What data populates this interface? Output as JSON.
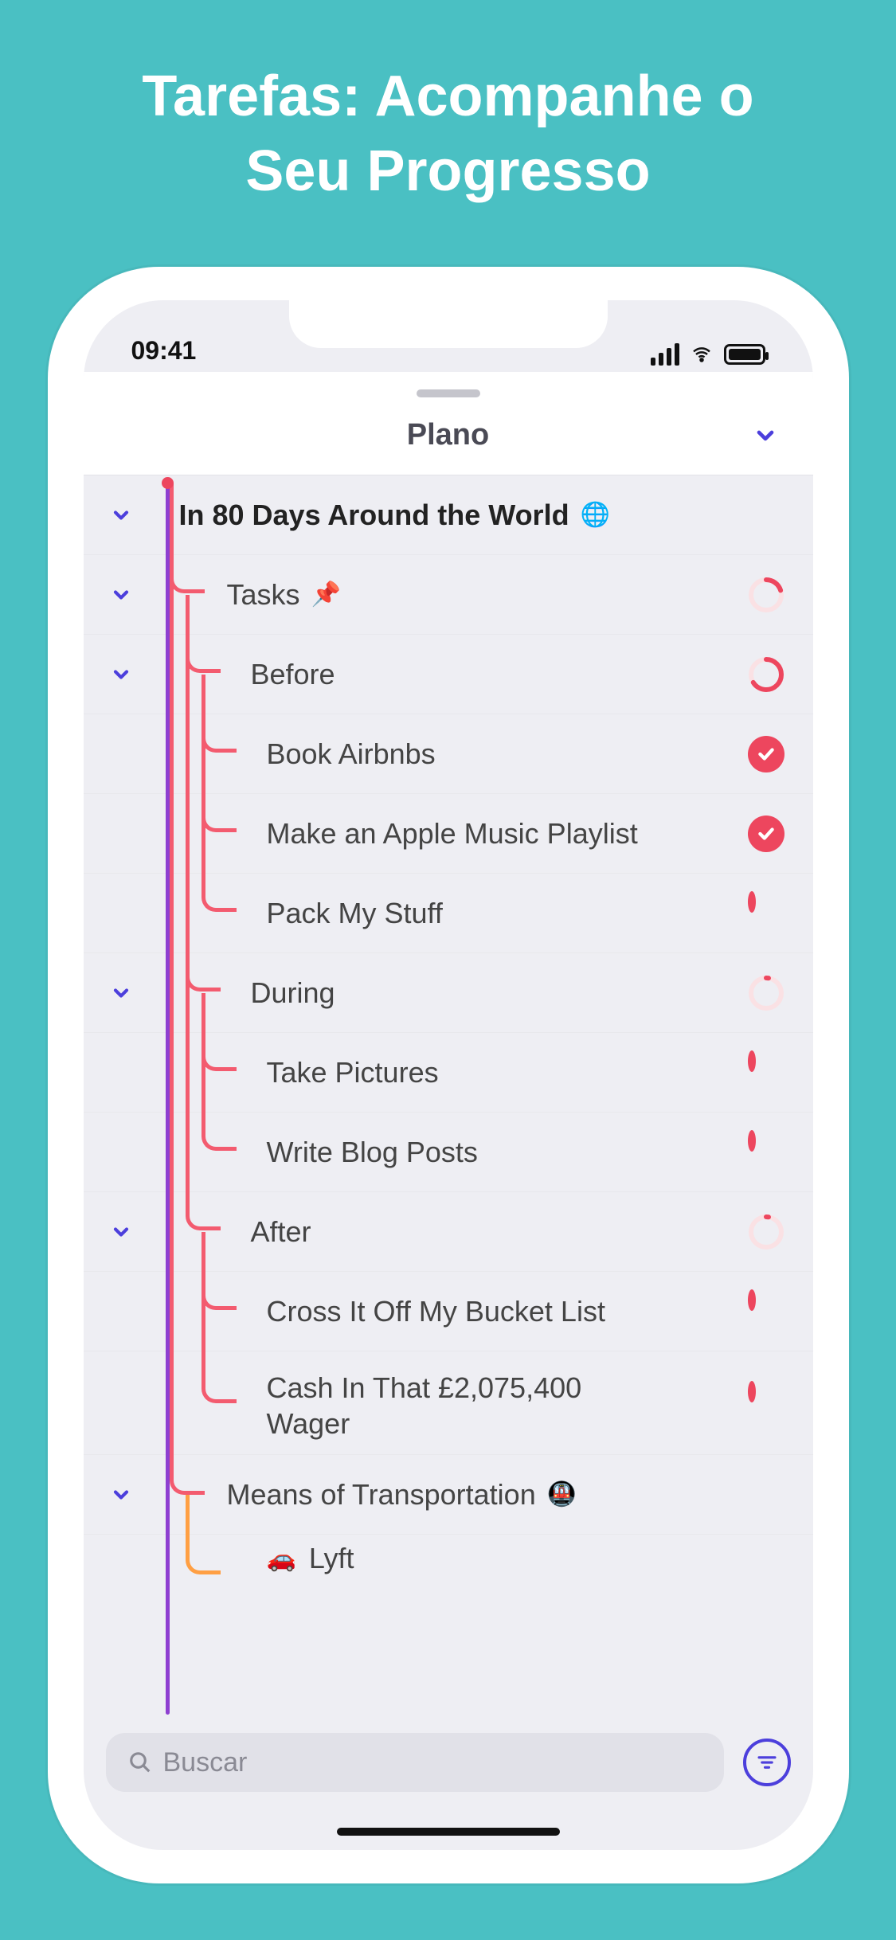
{
  "marketing": {
    "title_line1": "Tarefas: Acompanhe o",
    "title_line2": "Seu Progresso"
  },
  "statusbar": {
    "time": "09:41"
  },
  "header": {
    "title": "Plano"
  },
  "tree": {
    "root": {
      "label": "In 80 Days Around the World",
      "emoji": "🌐"
    },
    "tasks": {
      "label": "Tasks",
      "emoji": "📌"
    },
    "before": {
      "label": "Before",
      "items": [
        {
          "label": "Book Airbnbs",
          "done": true
        },
        {
          "label": "Make an Apple Music Playlist",
          "done": true
        },
        {
          "label": "Pack My Stuff",
          "done": false
        }
      ]
    },
    "during": {
      "label": "During",
      "items": [
        {
          "label": "Take Pictures",
          "done": false
        },
        {
          "label": "Write Blog Posts",
          "done": false
        }
      ]
    },
    "after": {
      "label": "After",
      "items": [
        {
          "label": "Cross It Off My Bucket List",
          "done": false
        },
        {
          "label": "Cash In That £2,075,400 Wager",
          "done": false
        }
      ]
    },
    "transport": {
      "label": "Means of Transportation",
      "emoji": "🚇",
      "items": [
        {
          "label": "Lyft",
          "emoji": "🚗"
        }
      ]
    }
  },
  "search": {
    "placeholder": "Buscar"
  },
  "colors": {
    "accent": "#4c3fdc",
    "task": "#ed465e",
    "bg": "#4ac0c3"
  }
}
